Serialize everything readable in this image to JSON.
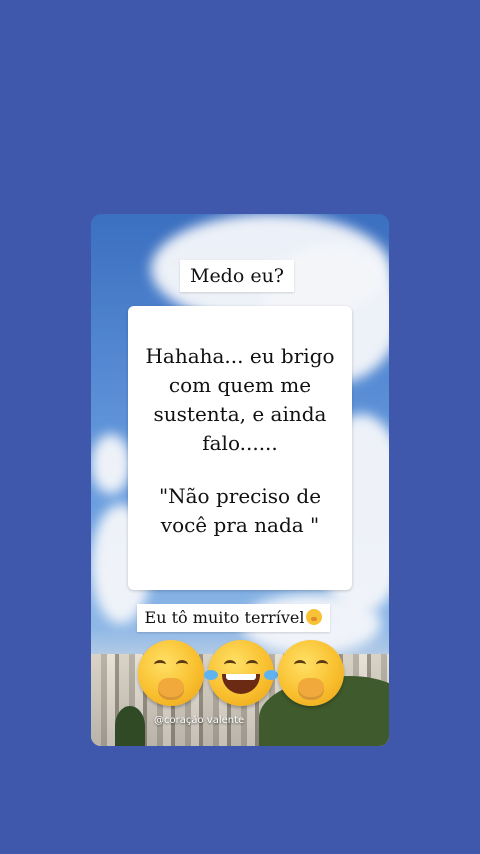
{
  "card": {
    "title": "Medo eu?",
    "main_text_1": "Hahaha... eu brigo\ncom quem me\nsustenta, e ainda\nfalo......",
    "main_text_2": "\"Não preciso de\nvocê pra nada \"",
    "bottom_text": "Eu tô muito terrível",
    "emojis": [
      "face-with-hand-over-mouth",
      "face-with-tears-of-joy",
      "face-with-hand-over-mouth"
    ],
    "credit": "@coração valente"
  },
  "colors": {
    "background": "#3f58ac",
    "label_background": "#ffffff",
    "text": "#111111"
  }
}
